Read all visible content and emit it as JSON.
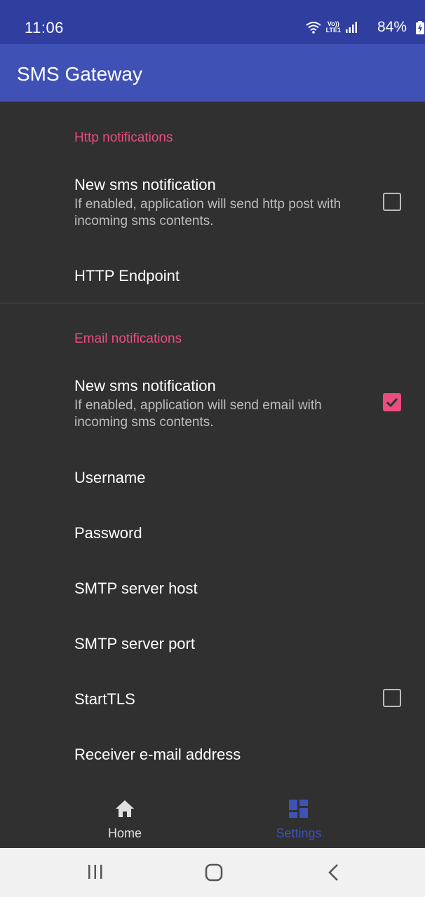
{
  "status_bar": {
    "time": "11:06",
    "volte_line1": "Vo))",
    "volte_line2": "LTE1",
    "battery": "84%"
  },
  "app": {
    "title": "SMS Gateway"
  },
  "http_section": {
    "header": "Http notifications",
    "new_sms": {
      "title": "New sms notification",
      "summary": "If enabled, application will send http post with incoming sms contents.",
      "checked": false
    },
    "endpoint": {
      "title": "HTTP Endpoint"
    }
  },
  "email_section": {
    "header": "Email notifications",
    "new_sms": {
      "title": "New sms notification",
      "summary": "If enabled, application will send email with incoming sms contents.",
      "checked": true
    },
    "username": {
      "title": "Username"
    },
    "password": {
      "title": "Password"
    },
    "smtp_host": {
      "title": "SMTP server host"
    },
    "smtp_port": {
      "title": "SMTP server port"
    },
    "starttls": {
      "title": "StartTLS",
      "checked": false
    },
    "receiver": {
      "title": "Receiver e-mail address"
    }
  },
  "bottom_nav": {
    "items": [
      {
        "label": "Home",
        "icon": "home-icon",
        "selected": false
      },
      {
        "label": "Settings",
        "icon": "dashboard-icon",
        "selected": true
      }
    ]
  },
  "system_nav": {
    "icons": [
      "recents-icon",
      "home-circle-icon",
      "back-icon"
    ]
  },
  "colors": {
    "status_bar": "#303f9f",
    "app_bar": "#3f51b5",
    "accent": "#ec4c7e",
    "background": "#303030"
  }
}
